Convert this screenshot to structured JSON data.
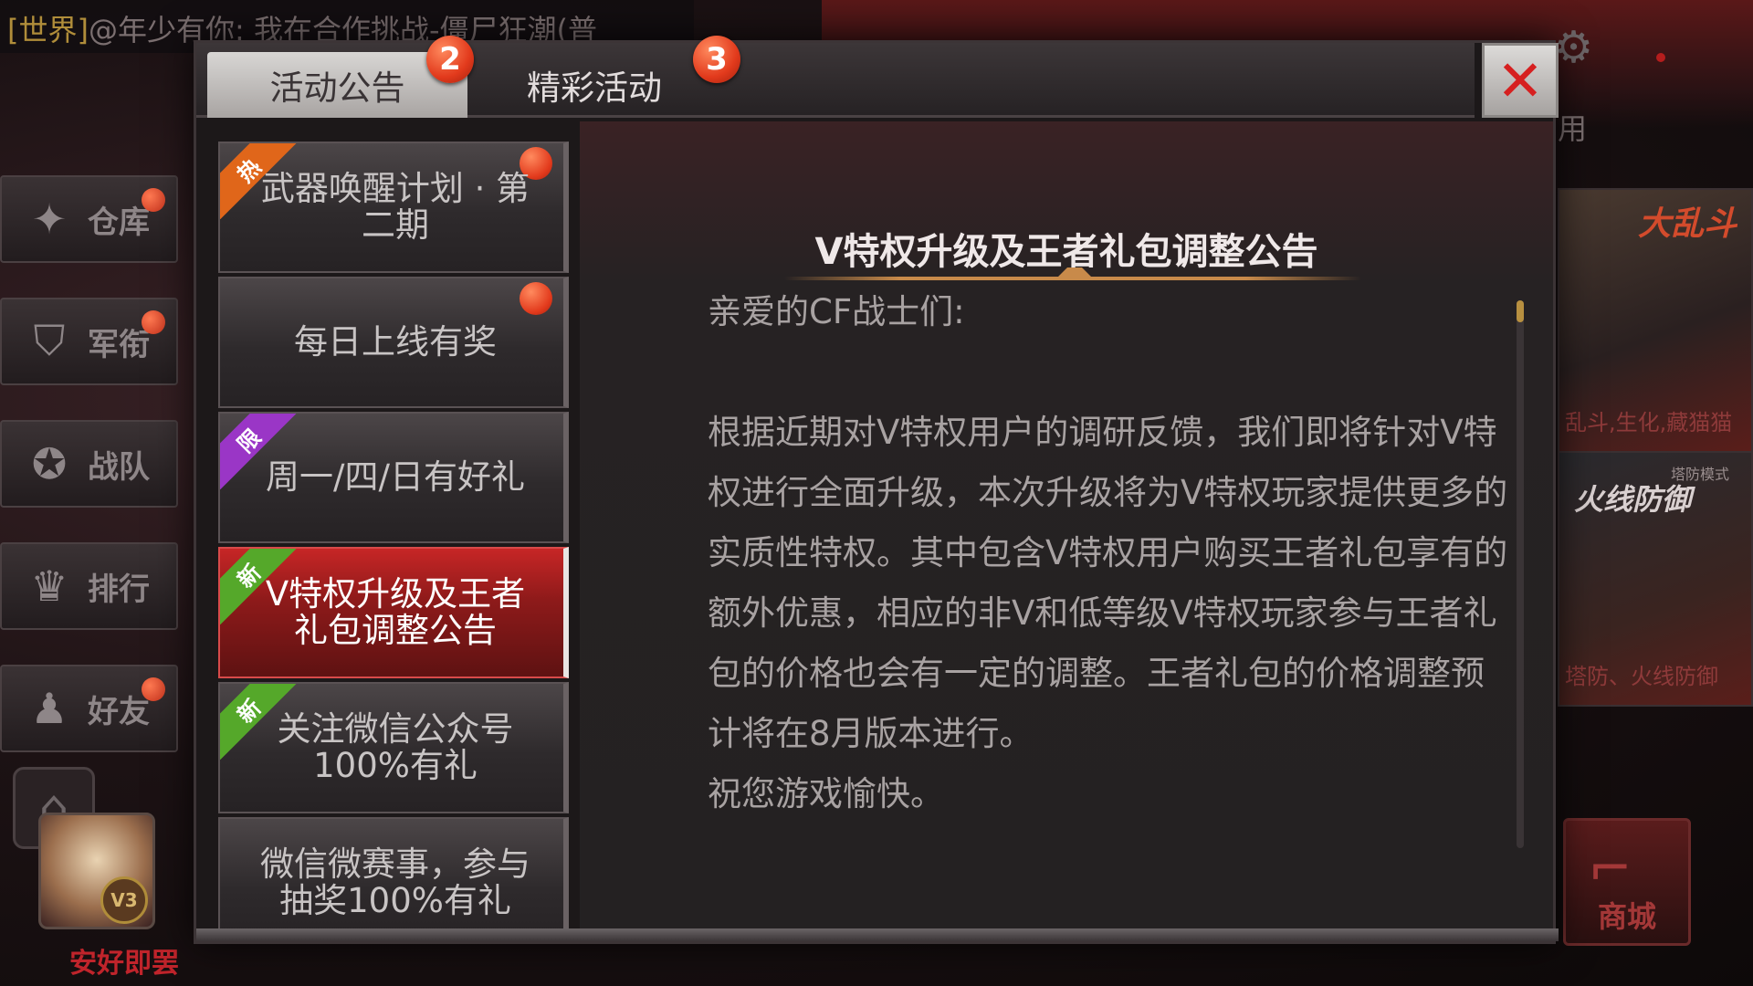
{
  "background": {
    "chat": {
      "channel_tag": "[世界]",
      "message": "@年少有你: 我在合作挑战-僵尸狂潮(普"
    },
    "partial_label": "用",
    "left_nav": [
      {
        "label": "仓库",
        "icon": "warehouse-icon",
        "has_dot": true
      },
      {
        "label": "军衔",
        "icon": "rank-icon",
        "has_dot": true
      },
      {
        "label": "战队",
        "icon": "team-icon",
        "has_dot": false
      },
      {
        "label": "排行",
        "icon": "trophy-icon",
        "has_dot": false
      },
      {
        "label": "好友",
        "icon": "friends-icon",
        "has_dot": true
      }
    ],
    "player": {
      "name": "安好即罢",
      "vip": "V3"
    },
    "right_panels": [
      {
        "title": "大乱斗",
        "small": "",
        "sub": "乱斗,生化,藏猫猫"
      },
      {
        "title": "火线防御",
        "small": "塔防模式",
        "sub": "塔防、火线防御"
      }
    ],
    "shop_label": "商城"
  },
  "modal": {
    "tabs": [
      {
        "label": "活动公告",
        "badge": "2",
        "active": true
      },
      {
        "label": "精彩活动",
        "badge": "3",
        "active": false
      }
    ],
    "close_glyph": "✕",
    "list_items": [
      {
        "label": "武器唤醒计划 · 第\n二期",
        "ribbon": "热",
        "ribbon_type": "hot",
        "has_dot": true,
        "active": false
      },
      {
        "label": "每日上线有奖",
        "ribbon": "",
        "ribbon_type": "",
        "has_dot": true,
        "active": false
      },
      {
        "label": "周一/四/日有好礼",
        "ribbon": "限",
        "ribbon_type": "limit",
        "has_dot": false,
        "active": false
      },
      {
        "label": "V特权升级及王者\n礼包调整公告",
        "ribbon": "新",
        "ribbon_type": "new",
        "has_dot": false,
        "active": true
      },
      {
        "label": "关注微信公众号\n100%有礼",
        "ribbon": "新",
        "ribbon_type": "new",
        "has_dot": false,
        "active": false
      },
      {
        "label": "微信微赛事，参与\n抽奖100%有礼",
        "ribbon": "",
        "ribbon_type": "",
        "has_dot": false,
        "active": false
      }
    ],
    "content": {
      "title": "V特权升级及王者礼包调整公告",
      "greeting": "亲爱的CF战士们:",
      "paragraph": "根据近期对V特权用户的调研反馈，我们即将针对V特权进行全面升级，本次升级将为V特权玩家提供更多的实质性特权。其中包含V特权用户购买王者礼包享有的额外优惠，相应的非V和低等级V特权玩家参与王者礼包的价格也会有一定的调整。王者礼包的价格调整预计将在8月版本进行。",
      "closing": "祝您游戏愉快。"
    }
  },
  "colors": {
    "accent_red": "#c72626",
    "badge": "#e23a1c",
    "title_line": "#c88a4a",
    "ribbon_hot": "#e0661a",
    "ribbon_limit": "#9a36c6",
    "ribbon_new": "#55a82a"
  }
}
